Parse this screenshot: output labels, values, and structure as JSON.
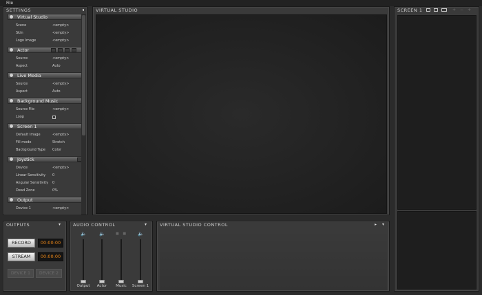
{
  "menu": {
    "file": "File"
  },
  "settings": {
    "title": "SETTINGS",
    "sections": [
      {
        "label": "Virtual Studio",
        "rows": [
          {
            "key": "Scene",
            "value": "<empty>"
          },
          {
            "key": "Skin",
            "value": "<empty>"
          },
          {
            "key": "Logo Image",
            "value": "<empty>"
          }
        ]
      },
      {
        "label": "Actor",
        "rows": [
          {
            "key": "Source",
            "value": "<empty>"
          },
          {
            "key": "Aspect",
            "value": "Auto"
          }
        ]
      },
      {
        "label": "Live Media",
        "rows": [
          {
            "key": "Source",
            "value": "<empty>"
          },
          {
            "key": "Aspect",
            "value": "Auto"
          }
        ]
      },
      {
        "label": "Background Music",
        "rows": [
          {
            "key": "Source File",
            "value": "<empty>"
          },
          {
            "key": "Loop",
            "value": ""
          }
        ]
      },
      {
        "label": "Screen 1",
        "rows": [
          {
            "key": "Default Image",
            "value": "<empty>"
          },
          {
            "key": "Fill mode",
            "value": "Stretch"
          },
          {
            "key": "Background Type",
            "value": "Color"
          }
        ]
      },
      {
        "label": "Joystick",
        "rows": [
          {
            "key": "Device",
            "value": "<empty>"
          },
          {
            "key": "Linear Sensitivity",
            "value": "0"
          },
          {
            "key": "Angular Sensitivity",
            "value": "0"
          },
          {
            "key": "Dead Zone",
            "value": "0%"
          }
        ]
      },
      {
        "label": "Output",
        "rows": [
          {
            "key": "Device 1",
            "value": "<empty>"
          }
        ]
      }
    ],
    "loop_checked": false
  },
  "virtual_studio": {
    "title": "VIRTUAL STUDIO"
  },
  "screen1": {
    "title": "SCREEN 1"
  },
  "outputs": {
    "title": "OUTPUTS",
    "record_label": "RECORD",
    "record_time": "00:00:00",
    "stream_label": "STREAM",
    "stream_time": "00:00:00",
    "device1_label": "DEVICE 1",
    "device2_label": "DEVICE 2"
  },
  "audio": {
    "title": "AUDIO CONTROL",
    "channels": [
      {
        "name": "Output",
        "level": 0.0
      },
      {
        "name": "Actor",
        "level": 0.0
      },
      {
        "name": "Music",
        "level": 0.0
      },
      {
        "name": "Screen 1",
        "level": 0.0
      }
    ]
  },
  "vs_control": {
    "title": "VIRTUAL STUDIO CONTROL"
  },
  "colors": {
    "timer": "#f08a18",
    "panel": "#3a3a3a",
    "canvas": "#1f1f1f"
  }
}
